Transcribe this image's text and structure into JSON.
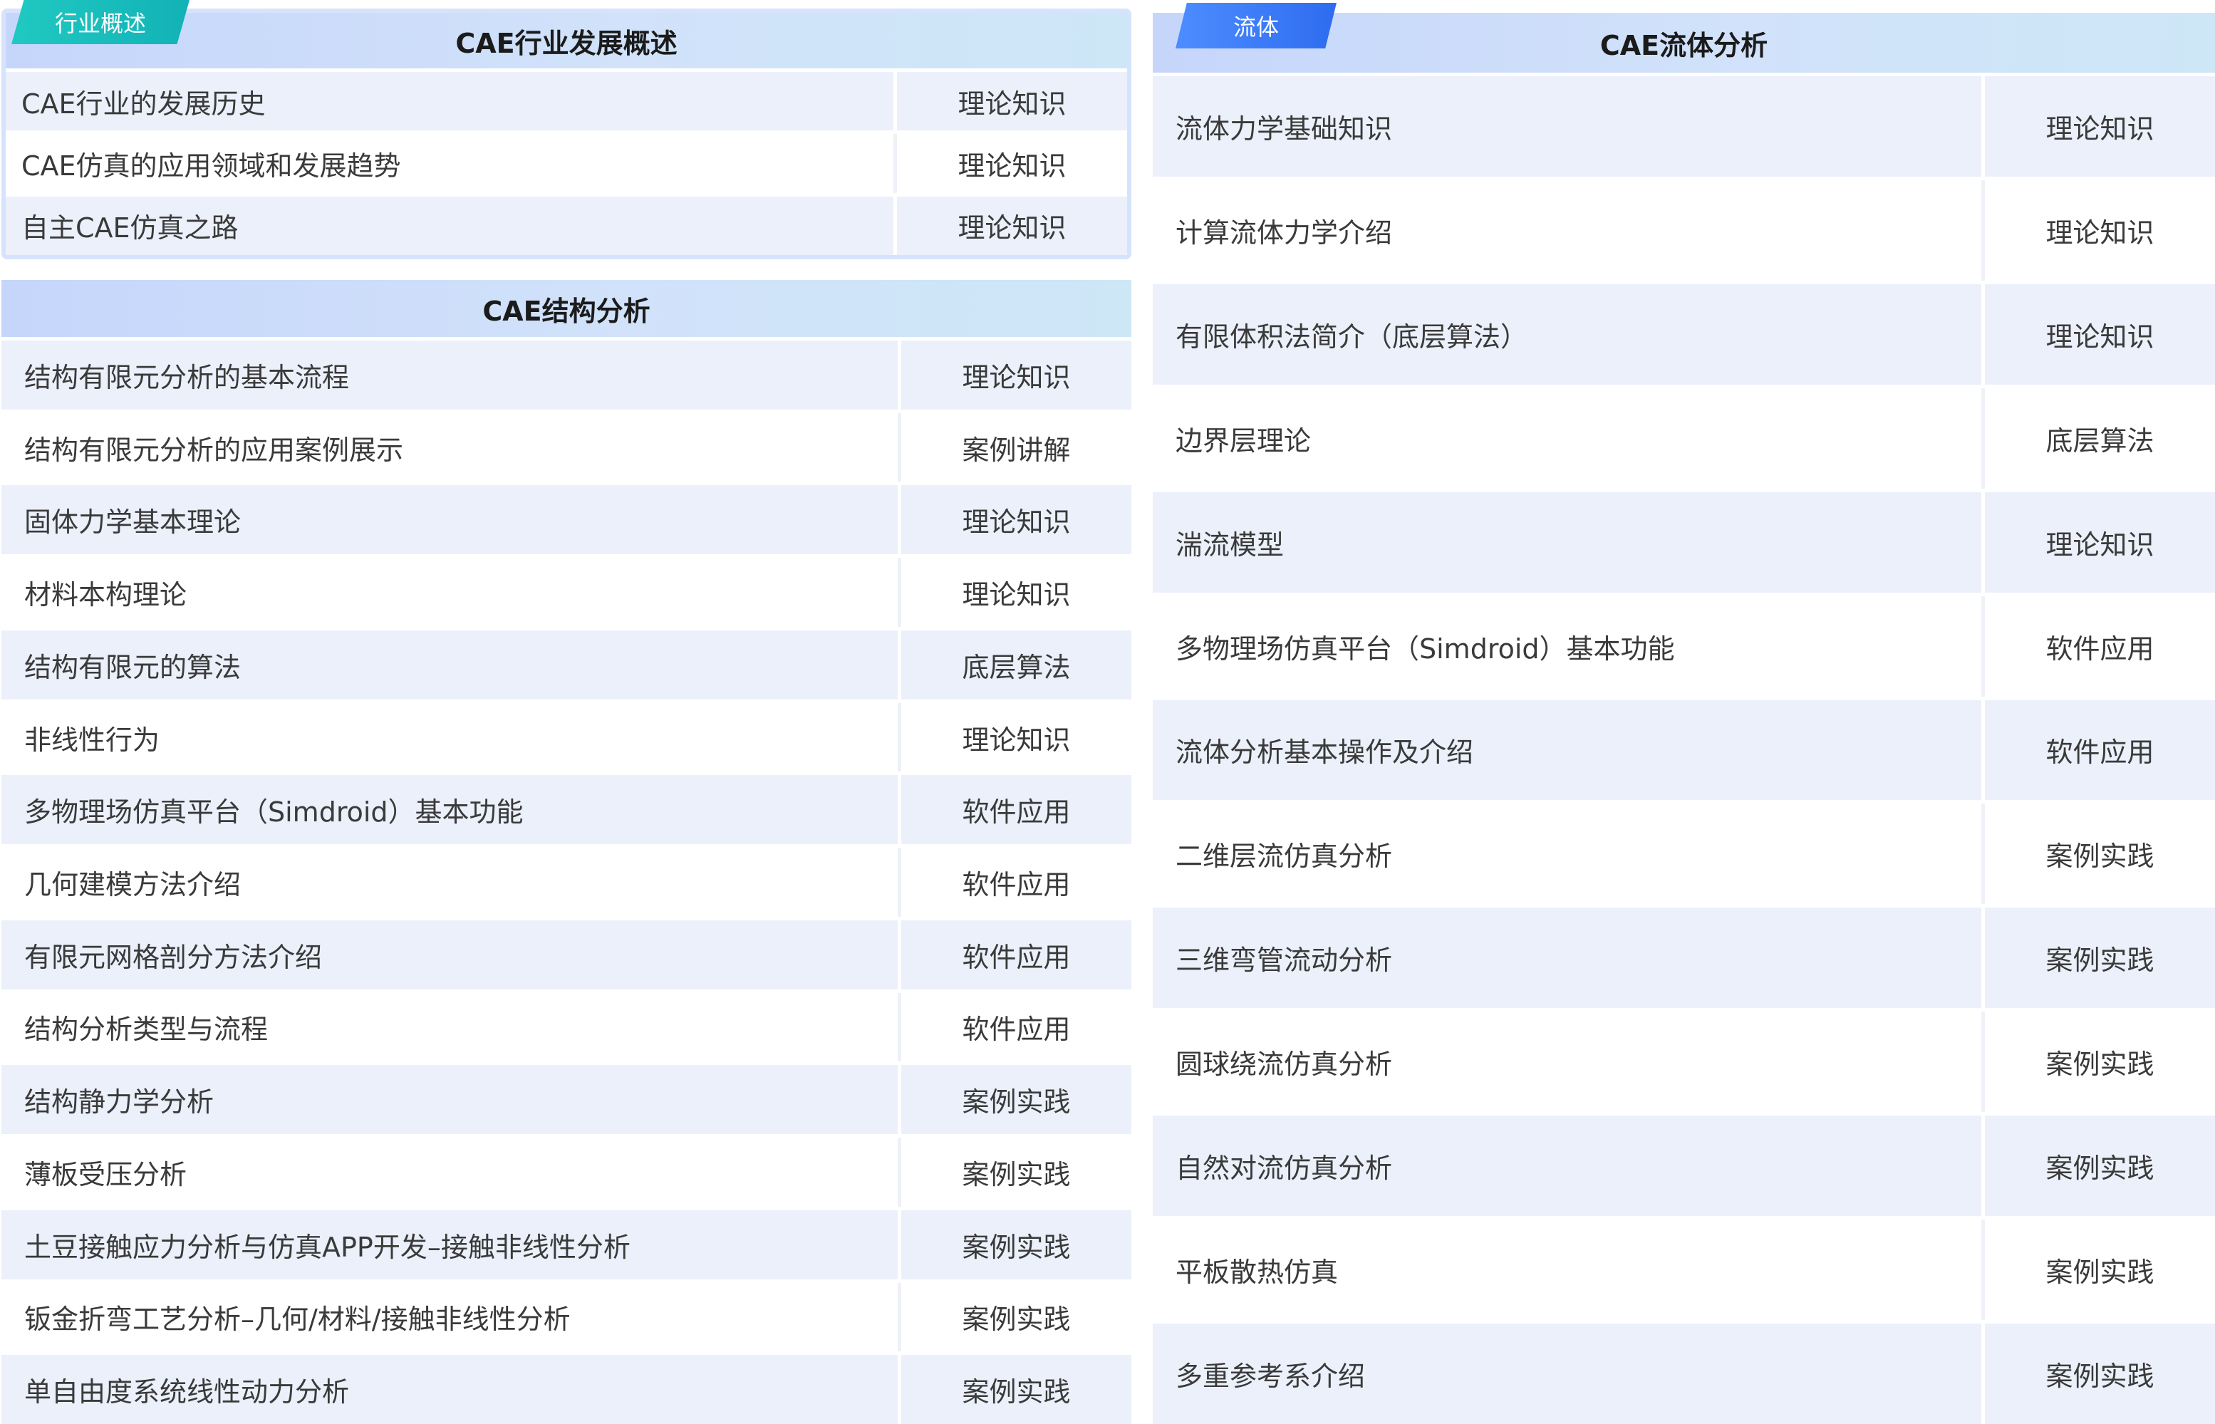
{
  "industry": {
    "tag": "行业概述",
    "title": "CAE行业发展概述",
    "rows": [
      {
        "name": "CAE行业的发展历史",
        "type": "理论知识"
      },
      {
        "name": "CAE仿真的应用领域和发展趋势",
        "type": "理论知识"
      },
      {
        "name": "自主CAE仿真之路",
        "type": "理论知识"
      }
    ]
  },
  "structure": {
    "title": "CAE结构分析",
    "rows": [
      {
        "name": "结构有限元分析的基本流程",
        "type": "理论知识"
      },
      {
        "name": "结构有限元分析的应用案例展示",
        "type": "案例讲解"
      },
      {
        "name": "固体力学基本理论",
        "type": "理论知识"
      },
      {
        "name": "材料本构理论",
        "type": "理论知识"
      },
      {
        "name": "结构有限元的算法",
        "type": "底层算法"
      },
      {
        "name": "非线性行为",
        "type": "理论知识"
      },
      {
        "name": "多物理场仿真平台（Simdroid）基本功能",
        "type": "软件应用"
      },
      {
        "name": "几何建模方法介绍",
        "type": "软件应用"
      },
      {
        "name": "有限元网格剖分方法介绍",
        "type": "软件应用"
      },
      {
        "name": "结构分析类型与流程",
        "type": "软件应用"
      },
      {
        "name": "结构静力学分析",
        "type": "案例实践"
      },
      {
        "name": "薄板受压分析",
        "type": "案例实践"
      },
      {
        "name": "土豆接触应力分析与仿真APP开发–接触非线性分析",
        "type": "案例实践"
      },
      {
        "name": "钣金折弯工艺分析–几何/材料/接触非线性分析",
        "type": "案例实践"
      },
      {
        "name": "单自由度系统线性动力分析",
        "type": "案例实践"
      }
    ]
  },
  "fluid": {
    "tag": "流体",
    "title": "CAE流体分析",
    "rows": [
      {
        "name": "流体力学基础知识",
        "type": "理论知识"
      },
      {
        "name": "计算流体力学介绍",
        "type": "理论知识"
      },
      {
        "name": "有限体积法简介（底层算法）",
        "type": "理论知识"
      },
      {
        "name": "边界层理论",
        "type": "底层算法"
      },
      {
        "name": "湍流模型",
        "type": "理论知识"
      },
      {
        "name": "多物理场仿真平台（Simdroid）基本功能",
        "type": "软件应用"
      },
      {
        "name": "流体分析基本操作及介绍",
        "type": "软件应用"
      },
      {
        "name": "二维层流仿真分析",
        "type": "案例实践"
      },
      {
        "name": "三维弯管流动分析",
        "type": "案例实践"
      },
      {
        "name": "圆球绕流仿真分析",
        "type": "案例实践"
      },
      {
        "name": "自然对流仿真分析",
        "type": "案例实践"
      },
      {
        "name": "平板散热仿真",
        "type": "案例实践"
      },
      {
        "name": "多重参考系介绍",
        "type": "案例实践"
      }
    ]
  }
}
